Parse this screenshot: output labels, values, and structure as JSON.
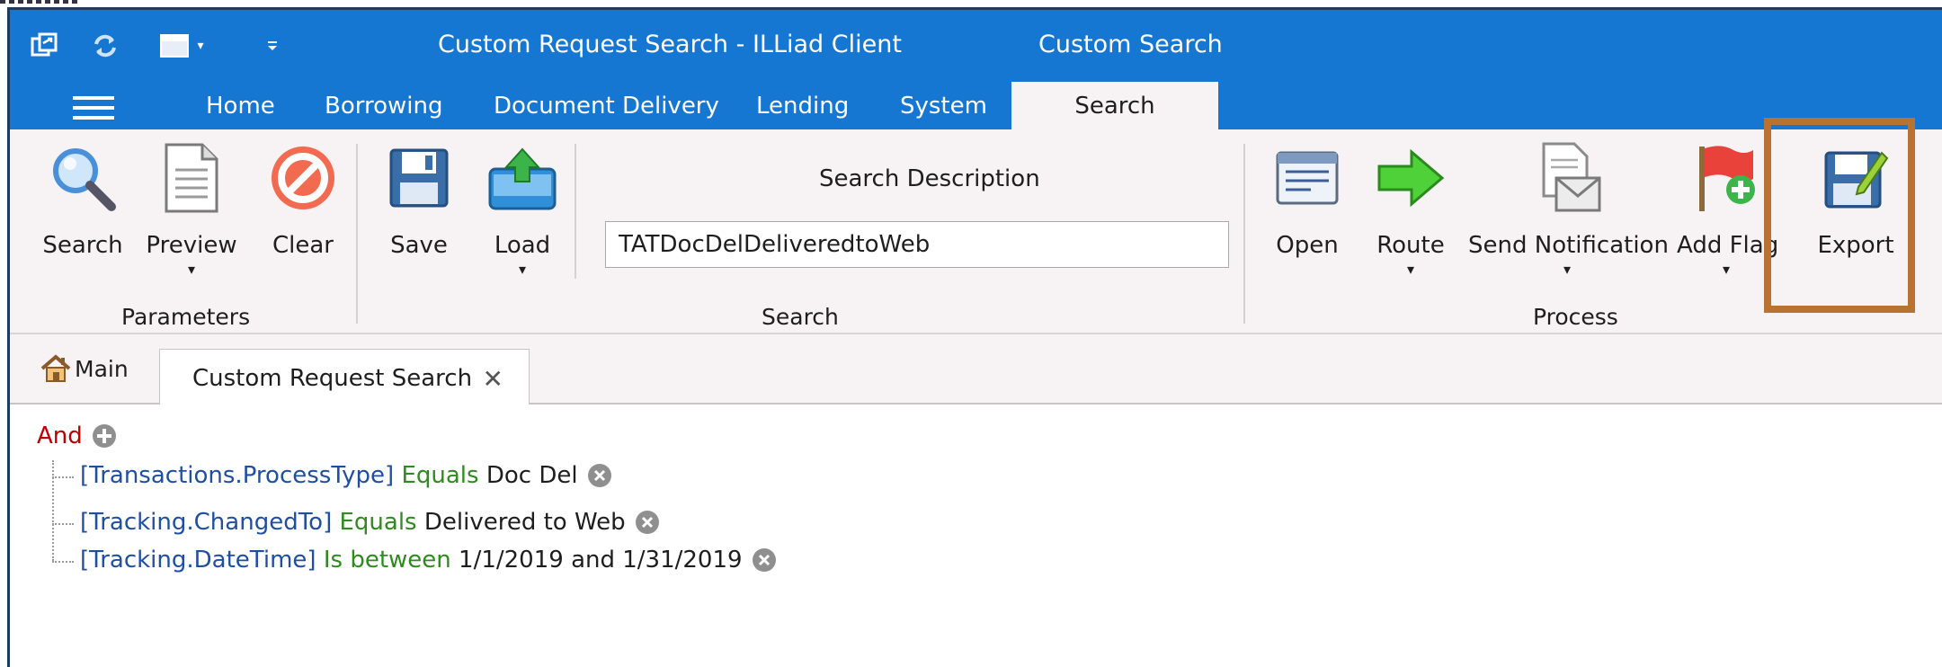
{
  "window": {
    "title": "Custom Request Search - ILLiad Client",
    "context_tab": "Custom Search"
  },
  "ribbon_tabs": [
    "Home",
    "Borrowing",
    "Document Delivery",
    "Lending",
    "System",
    "Search"
  ],
  "ribbon": {
    "parameters": {
      "group_label": "Parameters",
      "search_label": "Search",
      "preview_label": "Preview",
      "clear_label": "Clear"
    },
    "search_group": {
      "group_label": "Search",
      "save_label": "Save",
      "load_label": "Load",
      "description_label": "Search Description",
      "description_value": "TATDocDelDeliveredtoWeb"
    },
    "process": {
      "group_label": "Process",
      "open_label": "Open",
      "route_label": "Route",
      "send_notification_label": "Send Notification",
      "add_flag_label": "Add Flag",
      "export_label": "Export"
    },
    "dropdown_arrow": "▾"
  },
  "doc_tabs": {
    "main_label": "Main",
    "active_label": "Custom Request Search",
    "close_glyph": "✕"
  },
  "query": {
    "operator": "And",
    "conditions": [
      {
        "field": "[Transactions.ProcessType]",
        "condition": "Equals",
        "value": "Doc Del"
      },
      {
        "field": "[Tracking.ChangedTo]",
        "condition": "Equals",
        "value": "Delivered to Web"
      },
      {
        "field": "[Tracking.DateTime]",
        "condition": "Is between",
        "value": "1/1/2019 and 1/31/2019"
      }
    ]
  },
  "colors": {
    "titlebar": "#1677d2",
    "ribbon_bg": "#f7f3f5",
    "highlight_border": "#b87333",
    "operator": "#c00000",
    "field": "#1f4fa3",
    "condition": "#2e8b1e"
  },
  "icons": [
    "restore-icon",
    "refresh-icon",
    "save-menu-icon",
    "customize-icon",
    "search-magnifier-icon",
    "document-icon",
    "no-entry-icon",
    "floppy-icon",
    "load-icon",
    "open-list-icon",
    "route-arrow-icon",
    "envelope-icon",
    "flag-icon",
    "export-icon",
    "home-icon",
    "add-circle-icon",
    "remove-circle-icon"
  ]
}
